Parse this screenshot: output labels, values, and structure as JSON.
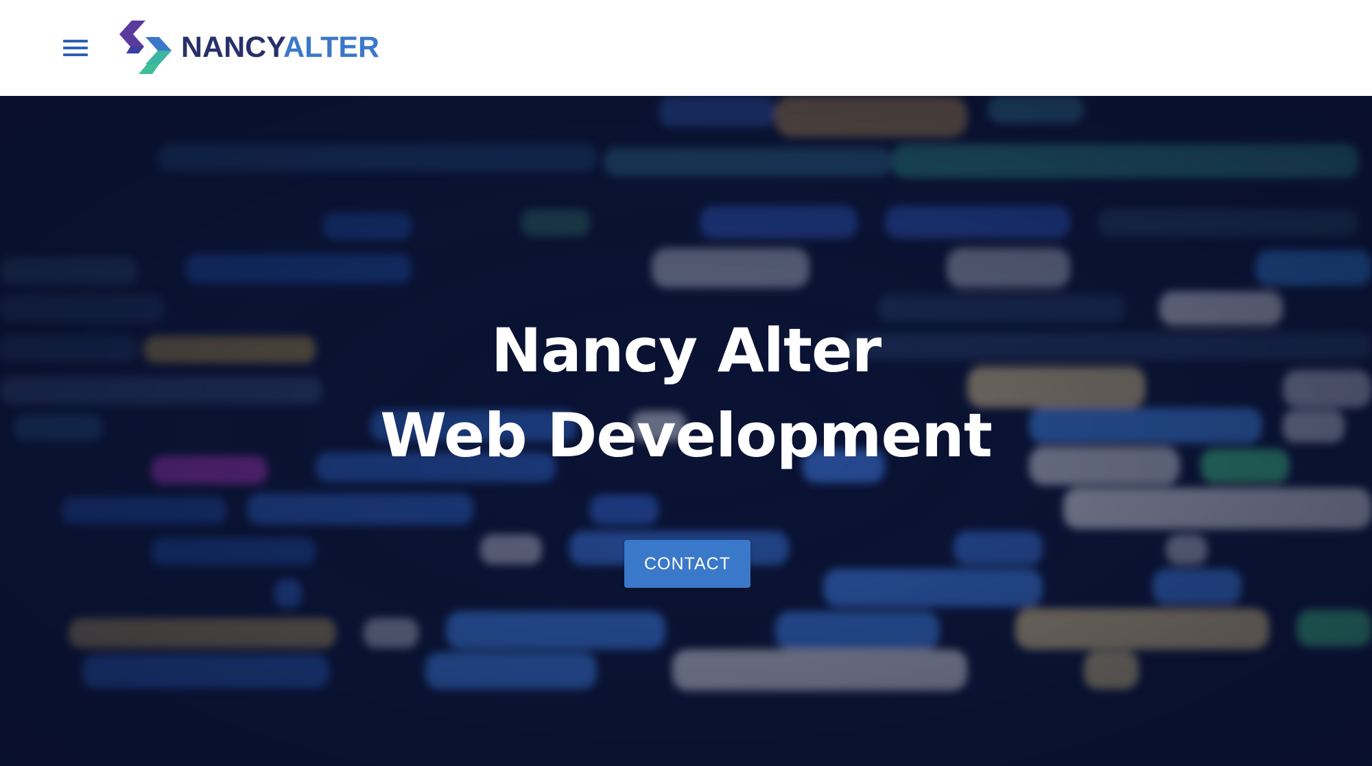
{
  "header": {
    "menu_icon": "hamburger-menu-icon",
    "logo": {
      "icon": "chevron-logo-icon",
      "text_first": "NANCY",
      "text_second": "ALTER",
      "colors": {
        "dark": "#27306b",
        "accent": "#3a78c9",
        "purple": "#5b3a9e",
        "green": "#3dbf9a"
      }
    }
  },
  "hero": {
    "title_line1": "Nancy Alter",
    "title_line2": "Web Development",
    "cta_label": "CONTACT",
    "background": "blurred-code-background",
    "cta_color": "#3a78c9"
  }
}
